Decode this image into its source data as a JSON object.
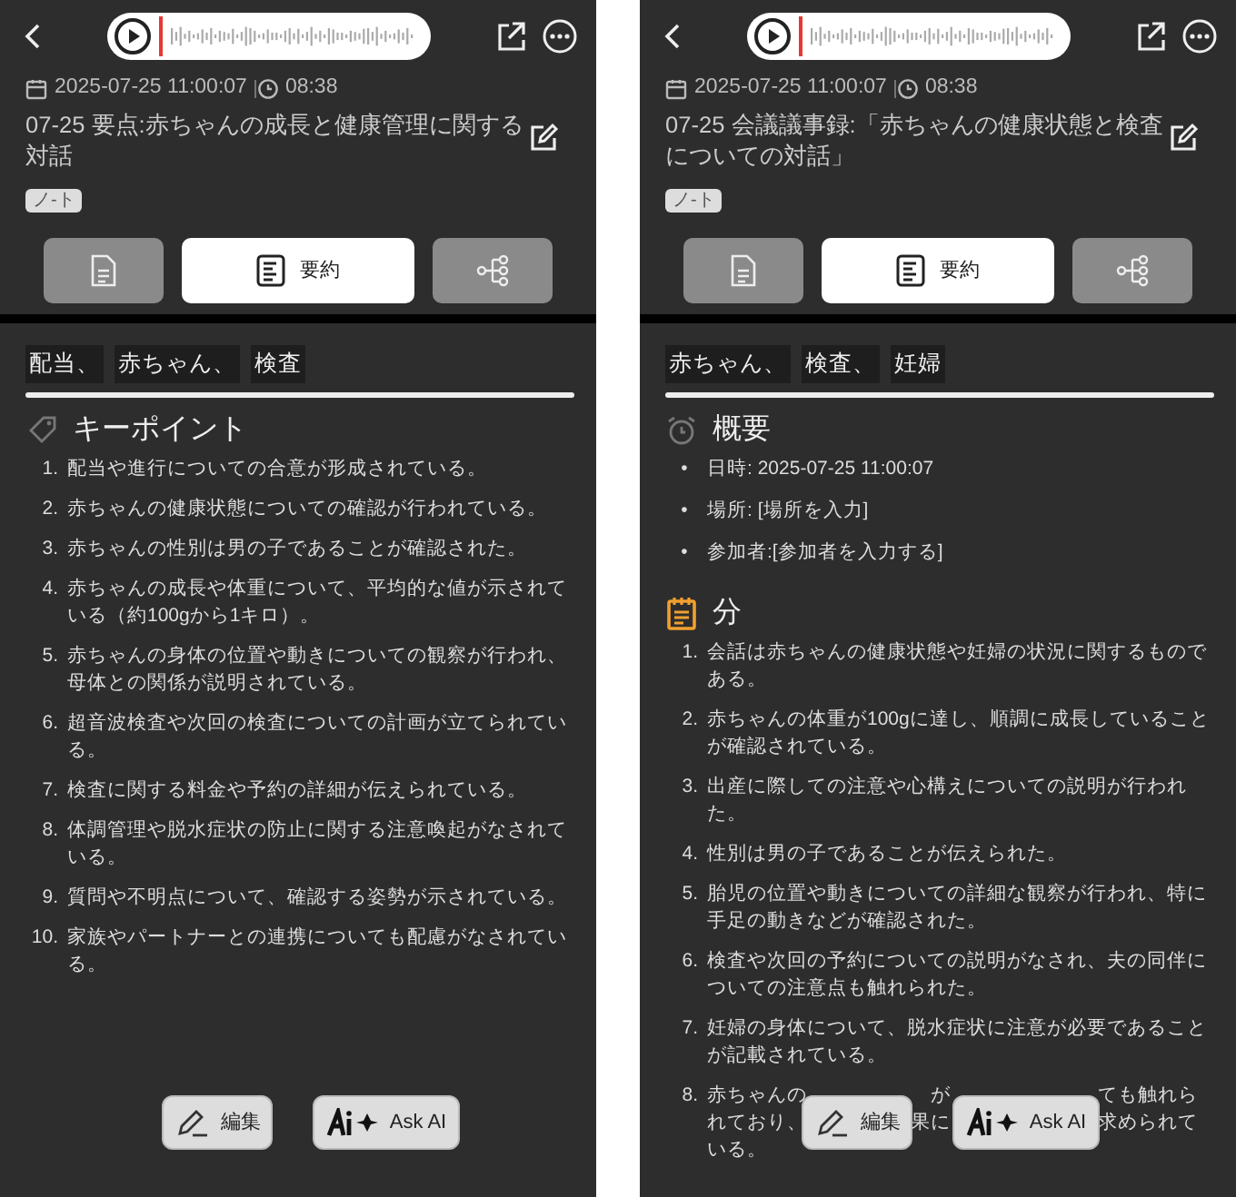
{
  "screens": [
    {
      "datetime": "2025-07-25 11:00:07",
      "duration": "08:38",
      "title": "07-25 要点:赤ちゃんの成長と健康管理に関する対話",
      "tag": "ノ-ト",
      "tabs": [
        {
          "kind": "transcript",
          "selected": false
        },
        {
          "kind": "summary",
          "label": "要約",
          "selected": true
        },
        {
          "kind": "mindmap",
          "selected": false
        }
      ],
      "keywords": [
        "配当、",
        "赤ちゃん、",
        "検査"
      ],
      "sections": [
        {
          "kind": "key_points",
          "heading": "キーポイント",
          "items": [
            {
              "marker": "1.",
              "text": "配当や進行についての合意が形成されている。"
            },
            {
              "marker": "2.",
              "text": "赤ちゃんの健康状態についての確認が行われている。"
            },
            {
              "marker": "3.",
              "text": "赤ちゃんの性別は男の子であることが確認された。"
            },
            {
              "marker": "4.",
              "text": "赤ちゃんの成長や体重について、平均的な値が示されている（約100gから1キロ）。"
            },
            {
              "marker": "5.",
              "text": "赤ちゃんの身体の位置や動きについての観察が行われ、母体との関係が説明されている。"
            },
            {
              "marker": "6.",
              "text": "超音波検査や次回の検査についての計画が立てられている。"
            },
            {
              "marker": "7.",
              "text": "検査に関する料金や予約の詳細が伝えられている。"
            },
            {
              "marker": "8.",
              "text": "体調管理や脱水症状の防止に関する注意喚起がなされている。"
            },
            {
              "marker": "9.",
              "text": "質問や不明点について、確認する姿勢が示されている。"
            },
            {
              "marker": "10.",
              "text": "家族やパートナーとの連携についても配慮がなされている。"
            }
          ]
        }
      ],
      "actions": [
        {
          "kind": "edit",
          "label": "編集"
        },
        {
          "kind": "ai",
          "label": "Ask AI"
        }
      ]
    },
    {
      "datetime": "2025-07-25 11:00:07",
      "duration": "08:38",
      "title": "07-25 会議議事録:「赤ちゃんの健康状態と検査についての対話」",
      "tag": "ノ-ト",
      "tabs": [
        {
          "kind": "transcript",
          "selected": false
        },
        {
          "kind": "summary",
          "label": "要約",
          "selected": true
        },
        {
          "kind": "mindmap",
          "selected": false
        }
      ],
      "keywords": [
        "赤ちゃん、",
        "検査、",
        "妊婦"
      ],
      "sections": [
        {
          "kind": "overview",
          "heading": "概要",
          "items": [
            {
              "marker": "•",
              "text": "日時: 2025-07-25 11:00:07"
            },
            {
              "marker": "•",
              "text": "場所: [場所を入力]"
            },
            {
              "marker": "•",
              "text": "参加者:[参加者を入力する]"
            }
          ]
        },
        {
          "kind": "minutes",
          "heading": "分",
          "items": [
            {
              "marker": "1.",
              "text": "会話は赤ちゃんの健康状態や妊婦の状況に関するものである。"
            },
            {
              "marker": "2.",
              "text": "赤ちゃんの体重が100gに達し、順調に成長していることが確認されている。"
            },
            {
              "marker": "3.",
              "text": "出産に際しての注意や心構えについての説明が行われた。"
            },
            {
              "marker": "4.",
              "text": "性別は男の子であることが伝えられた。"
            },
            {
              "marker": "5.",
              "text": "胎児の位置や動きについての詳細な観察が行われ、特に手足の動きなどが確認された。"
            },
            {
              "marker": "6.",
              "text": "検査や次回の予約についての説明がなされ、夫の同伴についての注意点も触れられた。"
            },
            {
              "marker": "7.",
              "text": "妊婦の身体について、脱水症状に注意が必要であることが記載されている。"
            },
            {
              "marker": "8.",
              "parts": [
                [
                  "赤ちゃんの",
                  "が",
                  "ても触れら"
                ],
                [
                  "れており、",
                  "果に",
                  "求められて"
                ],
                [
                  "いる。"
                ]
              ]
            }
          ]
        }
      ],
      "actions": [
        {
          "kind": "edit",
          "label": "編集"
        },
        {
          "kind": "ai",
          "label": "Ask AI"
        }
      ]
    }
  ]
}
